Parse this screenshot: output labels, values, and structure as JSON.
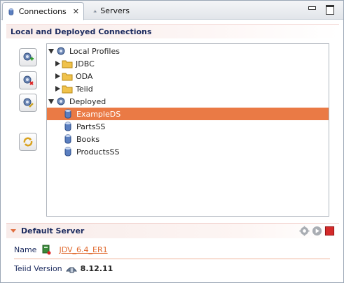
{
  "tabs": [
    {
      "label": "Connections",
      "active": true
    },
    {
      "label": "Servers",
      "active": false
    }
  ],
  "section_title": "Local and Deployed Connections",
  "side_buttons": [
    "new-connection-icon",
    "delete-connection-icon",
    "edit-connection-icon",
    "refresh-icon"
  ],
  "tree": {
    "local_profiles": "Local Profiles",
    "jdbc": "JDBC",
    "oda": "ODA",
    "teiid": "Teiid",
    "deployed": "Deployed",
    "sources": [
      "ExampleDS",
      "PartsSS",
      "Books",
      "ProductsSS"
    ],
    "selected": "ExampleDS"
  },
  "default_server": {
    "title": "Default Server",
    "name_label": "Name",
    "name_value": "JDV_6.4_ER1",
    "version_label": "Teiid Version",
    "version_value": "8.12.11"
  },
  "colors": {
    "selection": "#ea7a45",
    "link": "#e0682c",
    "header_text": "#1b2a5e"
  }
}
